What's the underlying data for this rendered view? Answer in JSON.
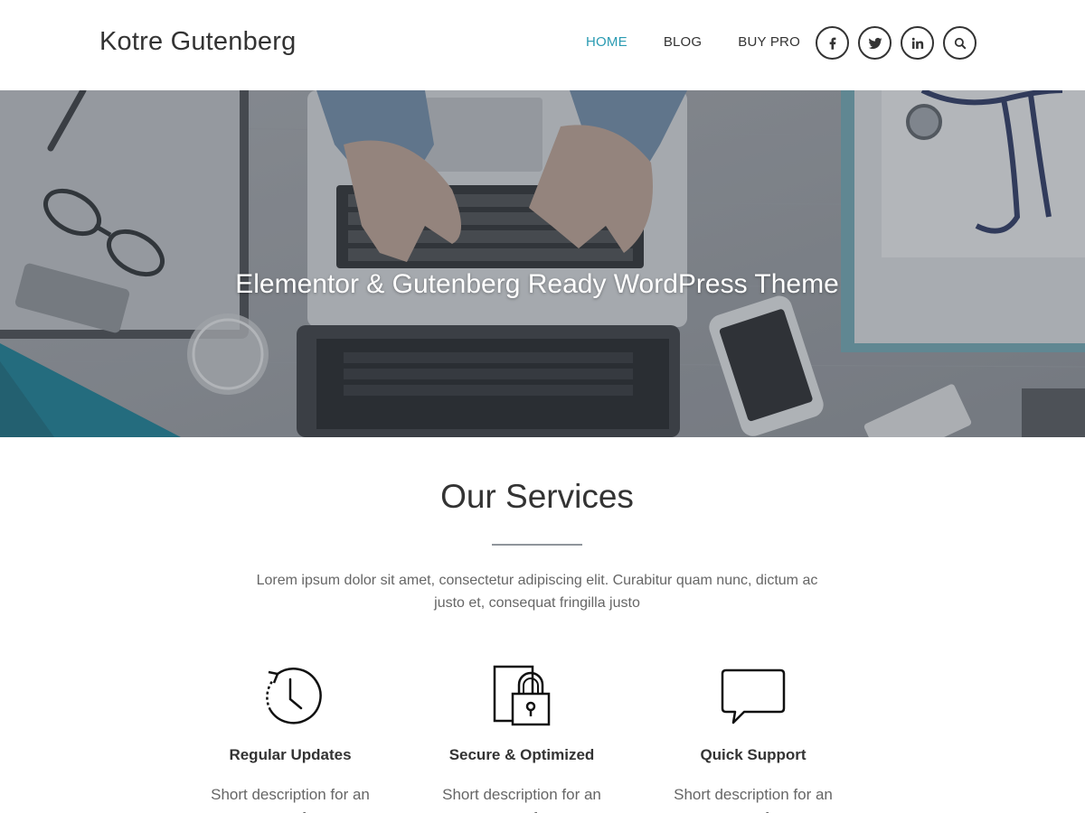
{
  "header": {
    "site_title": "Kotre Gutenberg",
    "nav": [
      {
        "label": "HOME",
        "active": true
      },
      {
        "label": "BLOG",
        "active": false
      },
      {
        "label": "BUY PRO",
        "active": false
      }
    ],
    "social_icons": [
      "facebook-icon",
      "twitter-icon",
      "linkedin-icon",
      "search-icon"
    ],
    "accent_color": "#2a9bb2"
  },
  "hero": {
    "title": "Elementor & Gutenberg Ready WordPress Theme"
  },
  "services": {
    "title": "Our Services",
    "description": "Lorem ipsum dolor sit amet, consectetur adipiscing elit. Curabitur quam nunc, dictum ac justo et, consequat fringilla justo",
    "items": [
      {
        "icon": "history-icon",
        "title": "Regular Updates",
        "description": "Short description for an awesome feature"
      },
      {
        "icon": "lock-icon",
        "title": "Secure & Optimized",
        "description": "Short description for an awesome feature"
      },
      {
        "icon": "speech-bubble-icon",
        "title": "Quick Support",
        "description": "Short description for an awesome feature"
      }
    ]
  }
}
